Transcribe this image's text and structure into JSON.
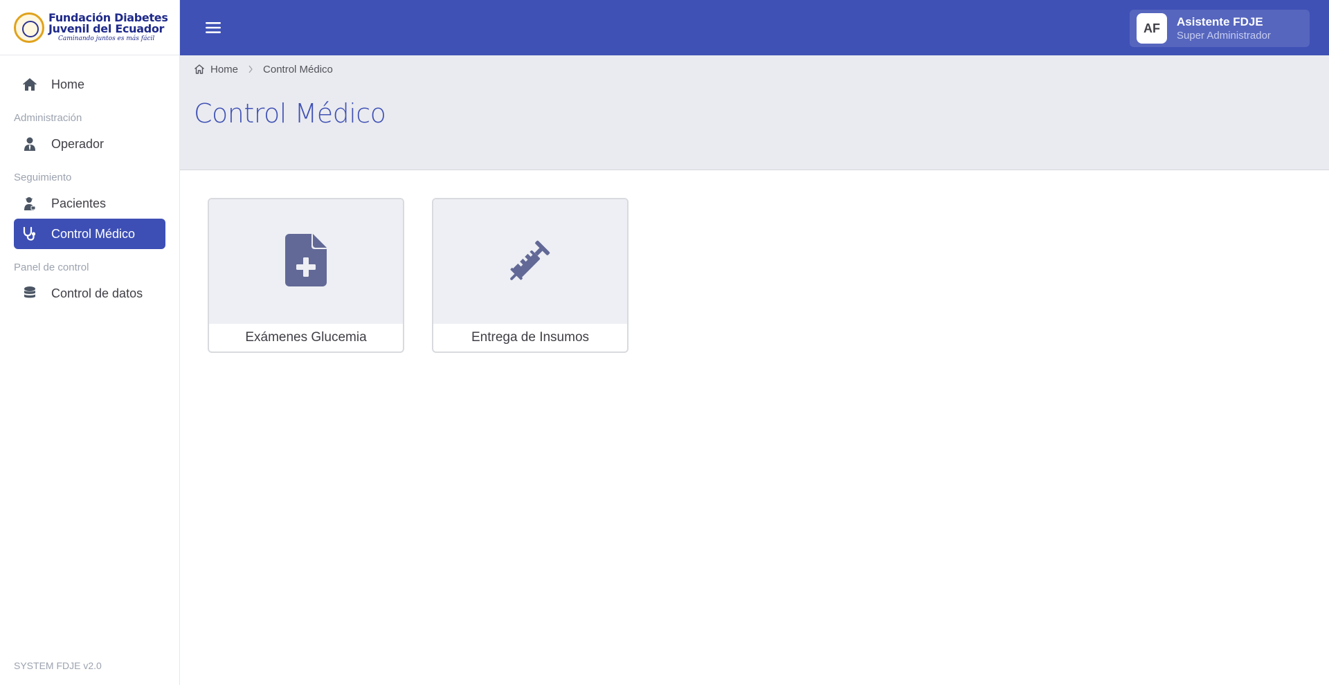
{
  "brand": {
    "line1": "Fundación Diabetes",
    "line2": "Juvenil del Ecuador",
    "tagline": "Caminando juntos es más fácil"
  },
  "sidebar": {
    "home": {
      "label": "Home",
      "icon": "home-icon"
    },
    "sections": [
      {
        "title": "Administración",
        "items": [
          {
            "label": "Operador",
            "icon": "user-tie-icon"
          }
        ]
      },
      {
        "title": "Seguimiento",
        "items": [
          {
            "label": "Pacientes",
            "icon": "patient-icon"
          },
          {
            "label": "Control Médico",
            "icon": "stethoscope-icon",
            "active": true
          }
        ]
      },
      {
        "title": "Panel de control",
        "items": [
          {
            "label": "Control de datos",
            "icon": "database-icon"
          }
        ]
      }
    ],
    "footer": "SYSTEM FDJE v2.0"
  },
  "topbar": {
    "menu_icon": "hamburger-menu-icon",
    "user": {
      "initials": "AF",
      "name": "Asistente FDJE",
      "role": "Super Administrador"
    }
  },
  "breadcrumb": {
    "home": "Home",
    "current": "Control Médico"
  },
  "page": {
    "title": "Control Médico"
  },
  "cards": [
    {
      "label": "Exámenes Glucemia",
      "icon": "file-medical-icon"
    },
    {
      "label": "Entrega de Insumos",
      "icon": "syringe-icon"
    }
  ],
  "colors": {
    "primary": "#3f51b5",
    "active_nav": "#3d4fb5",
    "header_band": "#eaebf0",
    "card_icon": "#626996"
  }
}
